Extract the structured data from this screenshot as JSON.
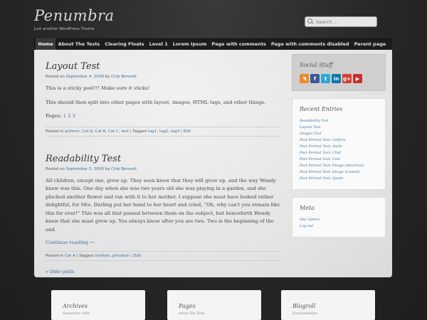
{
  "site": {
    "title": "Penumbra",
    "tagline": "Just another WordPress Theme"
  },
  "search": {
    "placeholder": "Search ..."
  },
  "nav": {
    "items": [
      "Home",
      "About The Tests",
      "Clearing Floats",
      "Level 1",
      "Lorem Ipsum",
      "Page with comments",
      "Page with comments disabled",
      "Parent page"
    ],
    "active": "Home"
  },
  "posts": [
    {
      "title": "Layout Test",
      "meta_prefix": "Posted on",
      "date": "September 4, 2008",
      "meta_by": "by",
      "author": "Chip Bennett",
      "paragraphs": [
        "This is a sticky post!!! Make sure it sticks!",
        "This should then split into other pages with layout, images, HTML tags, and other things."
      ],
      "pages_label": "Pages:",
      "pages": [
        "1",
        "2",
        "3"
      ],
      "footer": {
        "posted_in": "Posted in",
        "categories": "aciform, Cat A, Cat B, Cat C, test",
        "tagged_label": "| Tagged",
        "tags": "tag1, tag2, tag3",
        "edit": "| Edit"
      }
    },
    {
      "title": "Readability Test",
      "meta_prefix": "Posted on",
      "date": "September 5, 2008",
      "meta_by": "by",
      "author": "Chip Bennett",
      "body": "All children, except one, grow up. They soon know that they will grow up, and the way Wendy knew was this. One day when she was two years old she was playing in a garden, and she plucked another flower and ran with it to her mother. I suppose she must have looked rather delightful, for Mrs. Darling put her hand to her heart and cried, “Oh, why can't you remain like this for ever!” This was all that passed between them on the subject, but henceforth Wendy knew that she must grow up. You always know after you are two. Two is the beginning of the end.",
      "continue": "Continue reading →",
      "footer": {
        "posted_in": "Posted in",
        "categories": "Cat A",
        "tagged_label": "| Tagged",
        "tags": "chattels, privation",
        "edit": "| Edit"
      }
    }
  ],
  "older_posts": "« Older posts",
  "sidebar": {
    "social": {
      "title": "Social Stuff",
      "icons": [
        {
          "name": "rss-icon",
          "glyph": "◥",
          "color": "#f08a24"
        },
        {
          "name": "facebook-icon",
          "glyph": "f",
          "color": "#3b5998"
        },
        {
          "name": "twitter-icon",
          "glyph": "t",
          "color": "#2fa7d8"
        },
        {
          "name": "linkedin-icon",
          "glyph": "in",
          "color": "#0e76a8"
        },
        {
          "name": "googleplus-icon",
          "glyph": "g+",
          "color": "#d23f31"
        },
        {
          "name": "youtube-icon",
          "glyph": "▶",
          "color": "#c4302b"
        }
      ]
    },
    "recent": {
      "title": "Recent Entries",
      "items": [
        "Readability Test",
        "Layout Test",
        "Images Test",
        "Post Format Test: Gallery",
        "Post Format Test: Aside",
        "Post Format Test: Chat",
        "Post Format Test: Link",
        "Post Format Test: Image (Attached)",
        "Post Format Test: Image (Linked)",
        "Post Format Test: Quote"
      ]
    },
    "meta": {
      "title": "Meta",
      "items": [
        "Site Admin",
        "Log out"
      ]
    }
  },
  "footer_widgets": [
    {
      "title": "Archives",
      "sub": "September 2008"
    },
    {
      "title": "Pages",
      "sub": "About The Tests"
    },
    {
      "title": "Blogroll",
      "sub": "Documentation"
    }
  ]
}
